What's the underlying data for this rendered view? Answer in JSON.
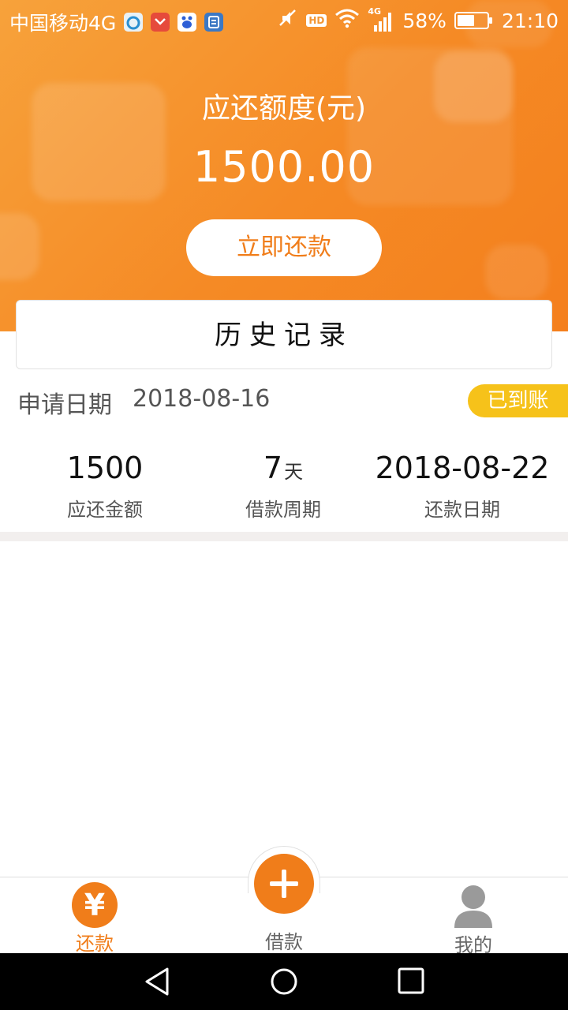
{
  "status_bar": {
    "carrier": "中国移动4G",
    "hd_badge": "HD",
    "network": "4G",
    "battery_percent": "58%",
    "battery_level": 0.58,
    "time": "21:10",
    "icons": [
      "app-circle-icon",
      "app-red-icon",
      "baidu-icon",
      "app-blue-icon",
      "mute-icon",
      "wifi-icon",
      "signal-icon",
      "battery-icon"
    ]
  },
  "header": {
    "title": "应还额度(元)",
    "amount": "1500.00",
    "repay_button": "立即还款"
  },
  "history": {
    "title": "历史记录"
  },
  "record": {
    "apply_label": "申请日期",
    "apply_date": "2018-08-16",
    "status_badge": "已到账",
    "stats": [
      {
        "value": "1500",
        "unit": "",
        "label": "应还金额"
      },
      {
        "value": "7",
        "unit": "天",
        "label": "借款周期"
      },
      {
        "value": "2018-08-22",
        "unit": "",
        "label": "还款日期"
      }
    ]
  },
  "tabs": [
    {
      "label": "还款",
      "icon": "yen-icon",
      "glyph": "¥",
      "active": true
    },
    {
      "label": "借款",
      "icon": "plus-icon",
      "active": false
    },
    {
      "label": "我的",
      "icon": "user-icon",
      "active": false
    }
  ],
  "colors": {
    "accent": "#f07d1a",
    "header_top": "#f7a23b",
    "header_bottom": "#f47f1d",
    "badge": "#f6c21a",
    "divider": "#f2efee"
  }
}
